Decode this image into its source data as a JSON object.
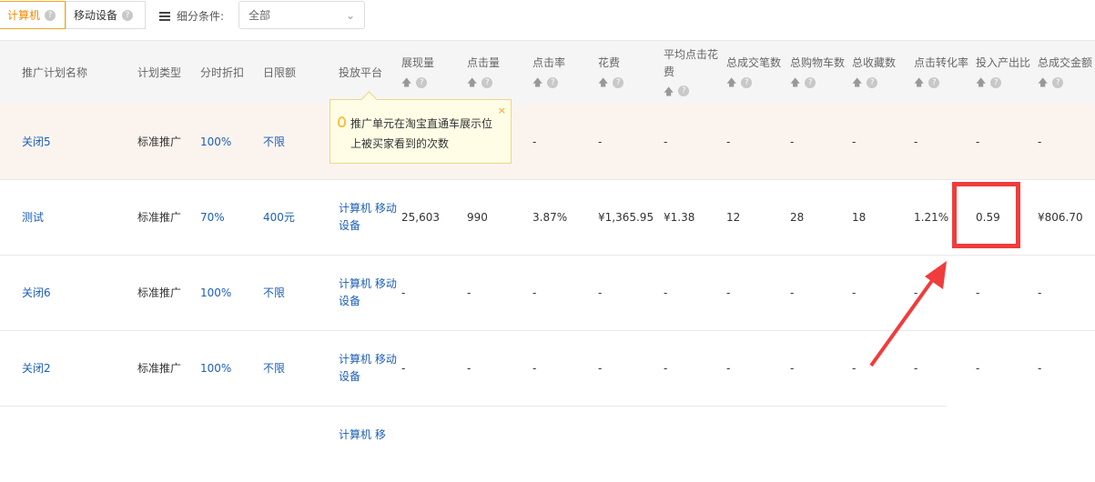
{
  "toolbar": {
    "tab_computer": "计算机",
    "tab_mobile": "移动设备",
    "filter_label": "细分条件:",
    "filter_value": "全部"
  },
  "columns": [
    {
      "label": "推广计划名称",
      "sortable": false
    },
    {
      "label": "计划类型",
      "sortable": false
    },
    {
      "label": "分时折扣",
      "sortable": false
    },
    {
      "label": "日限额",
      "sortable": false
    },
    {
      "label": "投放平台",
      "sortable": false
    },
    {
      "label": "展现量",
      "sortable": true
    },
    {
      "label": "点击量",
      "sortable": true
    },
    {
      "label": "点击率",
      "sortable": true
    },
    {
      "label": "花费",
      "sortable": true
    },
    {
      "label": "平均点击花费",
      "sortable": true
    },
    {
      "label": "总成交笔数",
      "sortable": true
    },
    {
      "label": "总购物车数",
      "sortable": true
    },
    {
      "label": "总收藏数",
      "sortable": true
    },
    {
      "label": "点击转化率",
      "sortable": true
    },
    {
      "label": "投入产出比",
      "sortable": true
    },
    {
      "label": "总成交金额",
      "sortable": true
    }
  ],
  "rows": [
    {
      "highlight": true,
      "cells": [
        "关闭5",
        "标准推广",
        "100%",
        "不限",
        "",
        "",
        "-",
        "-",
        "-",
        "-",
        "-",
        "-",
        "-",
        "-",
        "-",
        "-"
      ]
    },
    {
      "cells": [
        "测试",
        "标准推广",
        "70%",
        "400元",
        "计算机 移动设备",
        "25,603",
        "990",
        "3.87%",
        "¥1,365.95",
        "¥1.38",
        "12",
        "28",
        "18",
        "1.21%",
        "0.59",
        "¥806.70"
      ]
    },
    {
      "cells": [
        "关闭6",
        "标准推广",
        "100%",
        "不限",
        "计算机 移动设备",
        "-",
        "-",
        "-",
        "-",
        "-",
        "-",
        "-",
        "-",
        "-",
        "-",
        "-"
      ]
    },
    {
      "cells": [
        "关闭2",
        "标准推广",
        "100%",
        "不限",
        "计算机 移动设备",
        "-",
        "-",
        "-",
        "-",
        "-",
        "-",
        "-",
        "-",
        "-",
        "-",
        "-"
      ]
    },
    {
      "cells": [
        "",
        "",
        "",
        "",
        "计算机 移",
        "",
        "",
        "",
        "",
        "",
        "",
        "",
        "",
        "",
        "",
        ""
      ]
    }
  ],
  "tooltip": {
    "text": "推广单元在淘宝直通车展示位上被买家看到的次数",
    "close": "×"
  },
  "colors": {
    "accent": "#f08a00",
    "link": "#1c5fb8",
    "highlight_row": "#fbf4ee",
    "annotation": "#f03c3c"
  }
}
